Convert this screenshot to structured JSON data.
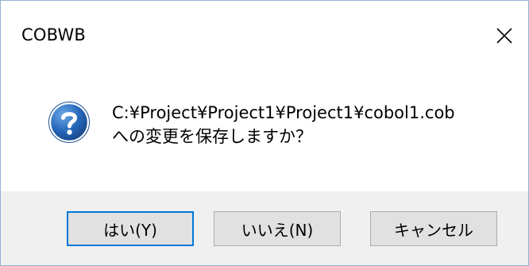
{
  "window": {
    "title": "COBWB",
    "close_icon": "close-icon"
  },
  "message": {
    "icon": "question-icon",
    "line1": "C:¥Project¥Project1¥Project1¥cobol1.cob",
    "line2": "への変更を保存しますか？"
  },
  "buttons": {
    "yes": "はい(Y)",
    "no": "いいえ(N)",
    "cancel": "キャンセル"
  },
  "colors": {
    "accent": "#0078d7",
    "icon_blue": "#1f63b3",
    "footer_bg": "#f0f0f0"
  }
}
